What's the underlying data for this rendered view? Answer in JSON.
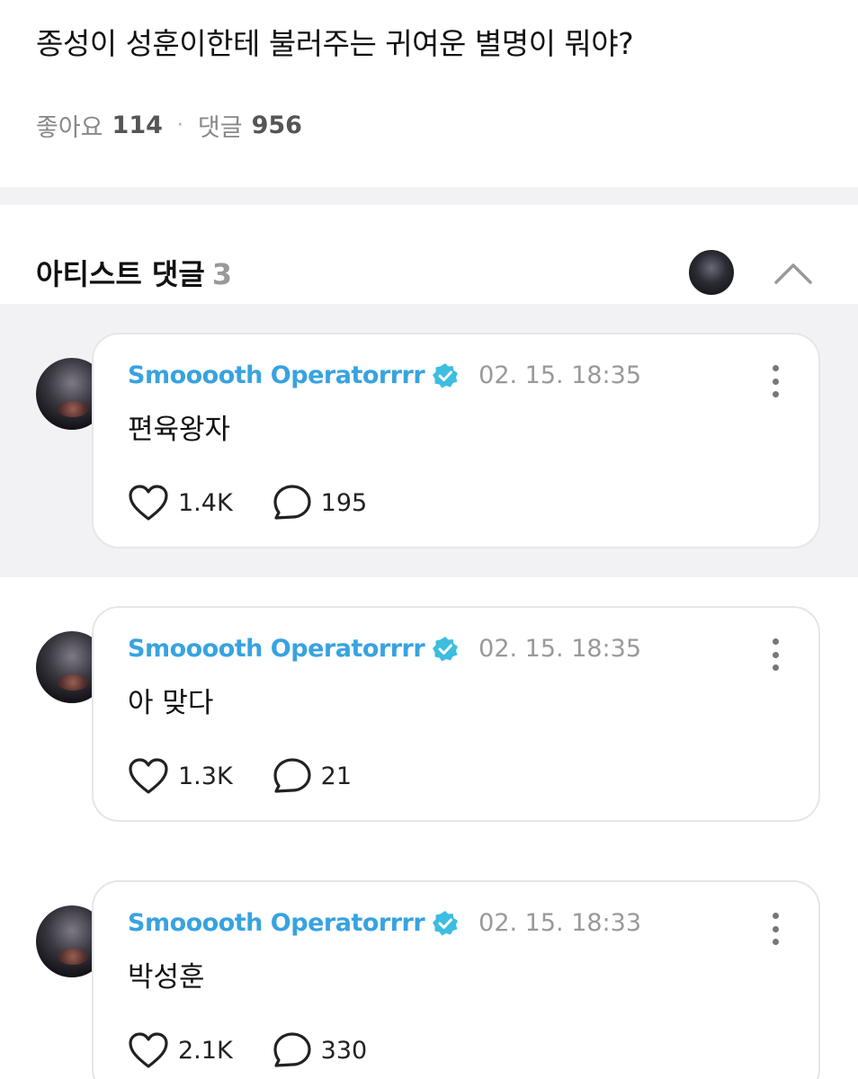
{
  "post": {
    "title": "종성이 성훈이한테 불러주는 귀여운 별명이 뭐야?",
    "likes_label": "좋아요",
    "likes_count": "114",
    "separator": "·",
    "comments_label": "댓글",
    "comments_count": "956"
  },
  "artist_section": {
    "title": "아티스트 댓글",
    "count": "3"
  },
  "comments": [
    {
      "author": "Smooooth Operatorrrr",
      "timestamp": "02. 15. 18:35",
      "text": "편육왕자",
      "likes": "1.4K",
      "replies": "195"
    },
    {
      "author": "Smooooth Operatorrrr",
      "timestamp": "02. 15. 18:35",
      "text": "아 맞다",
      "likes": "1.3K",
      "replies": "21"
    },
    {
      "author": "Smooooth Operatorrrr",
      "timestamp": "02. 15. 18:33",
      "text": "박성훈",
      "likes": "2.1K",
      "replies": "330"
    }
  ],
  "colors": {
    "author": "#38a3e0",
    "verified_badge": "#3dbde0",
    "band_gray": "#f2f2f4"
  }
}
